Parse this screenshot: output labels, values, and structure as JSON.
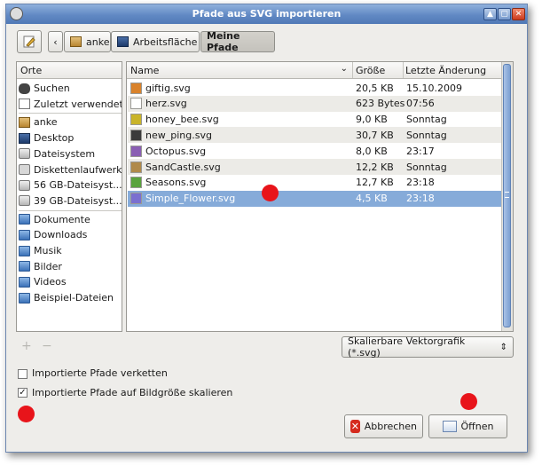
{
  "window": {
    "title": "Pfade aus SVG importieren"
  },
  "pathbar": {
    "back_label": "‹",
    "crumbs": [
      {
        "label": "anke",
        "icon": "home-folder-icon"
      },
      {
        "label": "Arbeitsfläche",
        "icon": "desktop-icon"
      },
      {
        "label": "Meine Pfade",
        "icon": ""
      }
    ]
  },
  "places": {
    "header": "Orte",
    "items": [
      {
        "label": "Suchen",
        "icon": "binoculars-icon"
      },
      {
        "label": "Zuletzt verwendet",
        "icon": "recent-document-icon"
      },
      {
        "label": "anke",
        "icon": "home-folder-icon"
      },
      {
        "label": "Desktop",
        "icon": "desktop-icon"
      },
      {
        "label": "Dateisystem",
        "icon": "drive-icon"
      },
      {
        "label": "Diskettenlaufwerk",
        "icon": "floppy-icon"
      },
      {
        "label": "56 GB-Dateisyst...",
        "icon": "drive-icon"
      },
      {
        "label": "39 GB-Dateisyst...",
        "icon": "drive-icon"
      },
      {
        "label": "Dokumente",
        "icon": "folder-icon"
      },
      {
        "label": "Downloads",
        "icon": "folder-icon"
      },
      {
        "label": "Musik",
        "icon": "folder-icon"
      },
      {
        "label": "Bilder",
        "icon": "folder-icon"
      },
      {
        "label": "Videos",
        "icon": "folder-icon"
      },
      {
        "label": "Beispiel-Dateien",
        "icon": "folder-icon"
      }
    ],
    "add_label": "+",
    "remove_label": "−"
  },
  "files": {
    "columns": {
      "name": "Name",
      "size": "Größe",
      "date": "Letzte Änderung"
    },
    "rows": [
      {
        "name": "giftig.svg",
        "size": "20,5 KB",
        "date": "15.10.2009",
        "icon": "poison-svg-icon",
        "color": "#d9822b"
      },
      {
        "name": "herz.svg",
        "size": "623 Bytes",
        "date": "07:56",
        "icon": "heart-svg-icon",
        "color": "#ffffff"
      },
      {
        "name": "honey_bee.svg",
        "size": "9,0 KB",
        "date": "Sonntag",
        "icon": "bee-svg-icon",
        "color": "#c9b42a"
      },
      {
        "name": "new_ping.svg",
        "size": "30,7 KB",
        "date": "Sonntag",
        "icon": "penguin-svg-icon",
        "color": "#3b3b3b"
      },
      {
        "name": "Octopus.svg",
        "size": "8,0 KB",
        "date": "23:17",
        "icon": "octopus-svg-icon",
        "color": "#8a5fb3"
      },
      {
        "name": "SandCastle.svg",
        "size": "12,2 KB",
        "date": "Sonntag",
        "icon": "sandcastle-svg-icon",
        "color": "#b08a4a"
      },
      {
        "name": "Seasons.svg",
        "size": "12,7 KB",
        "date": "23:18",
        "icon": "seasons-svg-icon",
        "color": "#5aa33e"
      },
      {
        "name": "Simple_Flower.svg",
        "size": "4,5 KB",
        "date": "23:18",
        "icon": "flower-svg-icon",
        "color": "#7a6fd0"
      }
    ],
    "selected_index": 7
  },
  "filter": {
    "value": "Skalierbare Vektorgrafik (*.svg)"
  },
  "options": [
    {
      "label": "Importierte Pfade verketten",
      "checked": false
    },
    {
      "label": "Importierte Pfade auf Bildgröße skalieren",
      "checked": true
    }
  ],
  "buttons": {
    "cancel": "Abbrechen",
    "open": "Öffnen"
  },
  "colors": {
    "selection": "#86abd9",
    "titlebar": "#6189c4",
    "marker": "#e8141a"
  }
}
